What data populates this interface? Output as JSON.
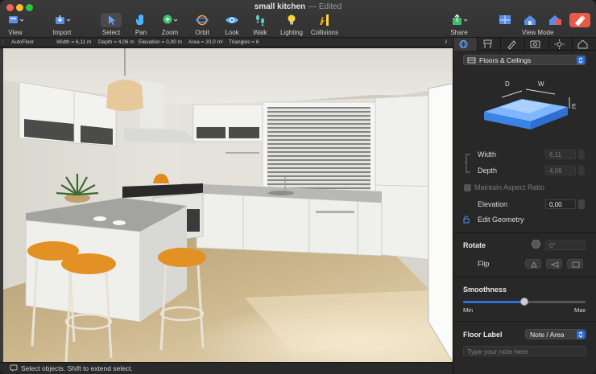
{
  "window": {
    "title": "small kitchen",
    "title_suffix": "— Edited"
  },
  "toolbar": {
    "view": "View",
    "import": "Import",
    "select": "Select",
    "pan": "Pan",
    "zoom": "Zoom",
    "orbit": "Orbit",
    "look": "Look",
    "walk": "Walk",
    "lighting": "Lighting",
    "collisions": "Collisions",
    "share": "Share",
    "view_mode": "View Mode"
  },
  "infobar": {
    "object": "AutoFloor",
    "width": "Width = 6,11 m",
    "depth": "Depth = 4,06 m",
    "elevation": "Elevation = 0,00 m",
    "area": "Area = 20,0 m²",
    "triangles": "Triangles = 6",
    "info_glyph": "i"
  },
  "status": {
    "message": "Select objects. Shift to extend select."
  },
  "inspector": {
    "category": "Floors & Ceilings",
    "diagram": {
      "d": "D",
      "w": "W",
      "e": "E"
    },
    "width_label": "Width",
    "width_value": "6,11",
    "depth_label": "Depth",
    "depth_value": "4,06",
    "maintain_label": "Maintain Aspect Ratio",
    "elevation_label": "Elevation",
    "elevation_value": "0,00",
    "edit_geometry_label": "Edit Geometry",
    "rotate_label": "Rotate",
    "rotate_value": "0°",
    "flip_label": "Flip",
    "smoothness_label": "Smoothness",
    "smoothness_level": 0.5,
    "min_label": "Min",
    "max_label": "Max",
    "floor_label": "Floor Label",
    "floor_label_option": "Note / Area",
    "note_placeholder": "Type your note here"
  },
  "colors": {
    "accent": "#2f6fde",
    "toolbar_bg": "#363636",
    "panel_bg": "#282828"
  }
}
